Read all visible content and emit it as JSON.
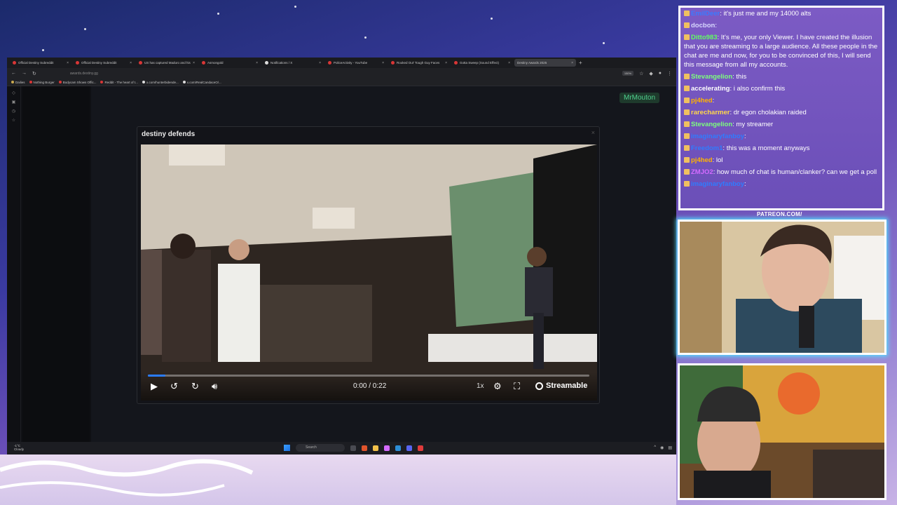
{
  "browser": {
    "tabs": [
      {
        "label": "Official Destiny Subreddit",
        "active": false
      },
      {
        "label": "Official Destiny Subreddit",
        "active": false
      },
      {
        "label": "US has captured Maduro and his",
        "active": false
      },
      {
        "label": "Asmongold",
        "active": false
      },
      {
        "label": "Notifications / X",
        "active": false
      },
      {
        "label": "PoliceActivity - YouTube",
        "active": false
      },
      {
        "label": "Rooked Out' Tough Guy Faces",
        "active": false
      },
      {
        "label": "Gotta Sweep (Sound Effect)",
        "active": false
      },
      {
        "label": "Destiny Awards 2025",
        "active": true
      }
    ],
    "url": "awards.destiny.gg",
    "zoom": "150%",
    "bookmarks": [
      "Dailies",
      "Nothing Burger",
      "Bodycam Shows Offic...",
      "Reddit - The heart of t...",
      "x.com/hunterbidende...",
      "x.com/RealCandaceO/..."
    ],
    "username_tag": "MrMouton"
  },
  "modal": {
    "title": "destiny defends",
    "time": "0:00 / 0:22",
    "progress": 0.04,
    "speed": "1x",
    "brand": "Streamable"
  },
  "taskbar": {
    "weather_temp": "-1°C",
    "weather_cond": "Cloudy",
    "search_placeholder": "Search"
  },
  "chat": {
    "messages": [
      {
        "user": "EmilDeer",
        "text": "it's just me and my 14000 alts",
        "color": "#3a7bff"
      },
      {
        "user": "docbon",
        "text": "",
        "color": "#d8d8ff"
      },
      {
        "user": "Ditto983",
        "text": "It's me, your only Viewer. I have created the illusion that you are streaming to a large audience. All these people in the chat are me and now, for you to be convinced of this, I will send this message from all my accounts.",
        "color": "#62ff62"
      },
      {
        "user": "Stevangelion",
        "text": "this",
        "color": "#7dff7d"
      },
      {
        "user": "accelerating",
        "text": "i also confirm this",
        "color": "#ffffff"
      },
      {
        "user": "pj4hed",
        "text": "",
        "color": "#ffb300"
      },
      {
        "user": "rarecharmer",
        "text": "dr egon cholakian raided",
        "color": "#ffd84a"
      },
      {
        "user": "Stevangelion",
        "text": "my streamer",
        "color": "#7dff7d"
      },
      {
        "user": "imaginaryfanboy",
        "text": "",
        "color": "#2f7cff"
      },
      {
        "user": "Freedom1",
        "text": "this was a moment anyways",
        "color": "#2f7cff"
      },
      {
        "user": "pj4hed",
        "text": "lol",
        "color": "#ffb300"
      },
      {
        "user": "ZMJO2",
        "text": "how much of chat is human/clanker? can we get a poll",
        "color": "#d36bff"
      },
      {
        "user": "imaginaryfanboy",
        "text": "",
        "color": "#2f7cff"
      }
    ]
  },
  "overlay": {
    "patreon": "PATREON.COM/"
  }
}
